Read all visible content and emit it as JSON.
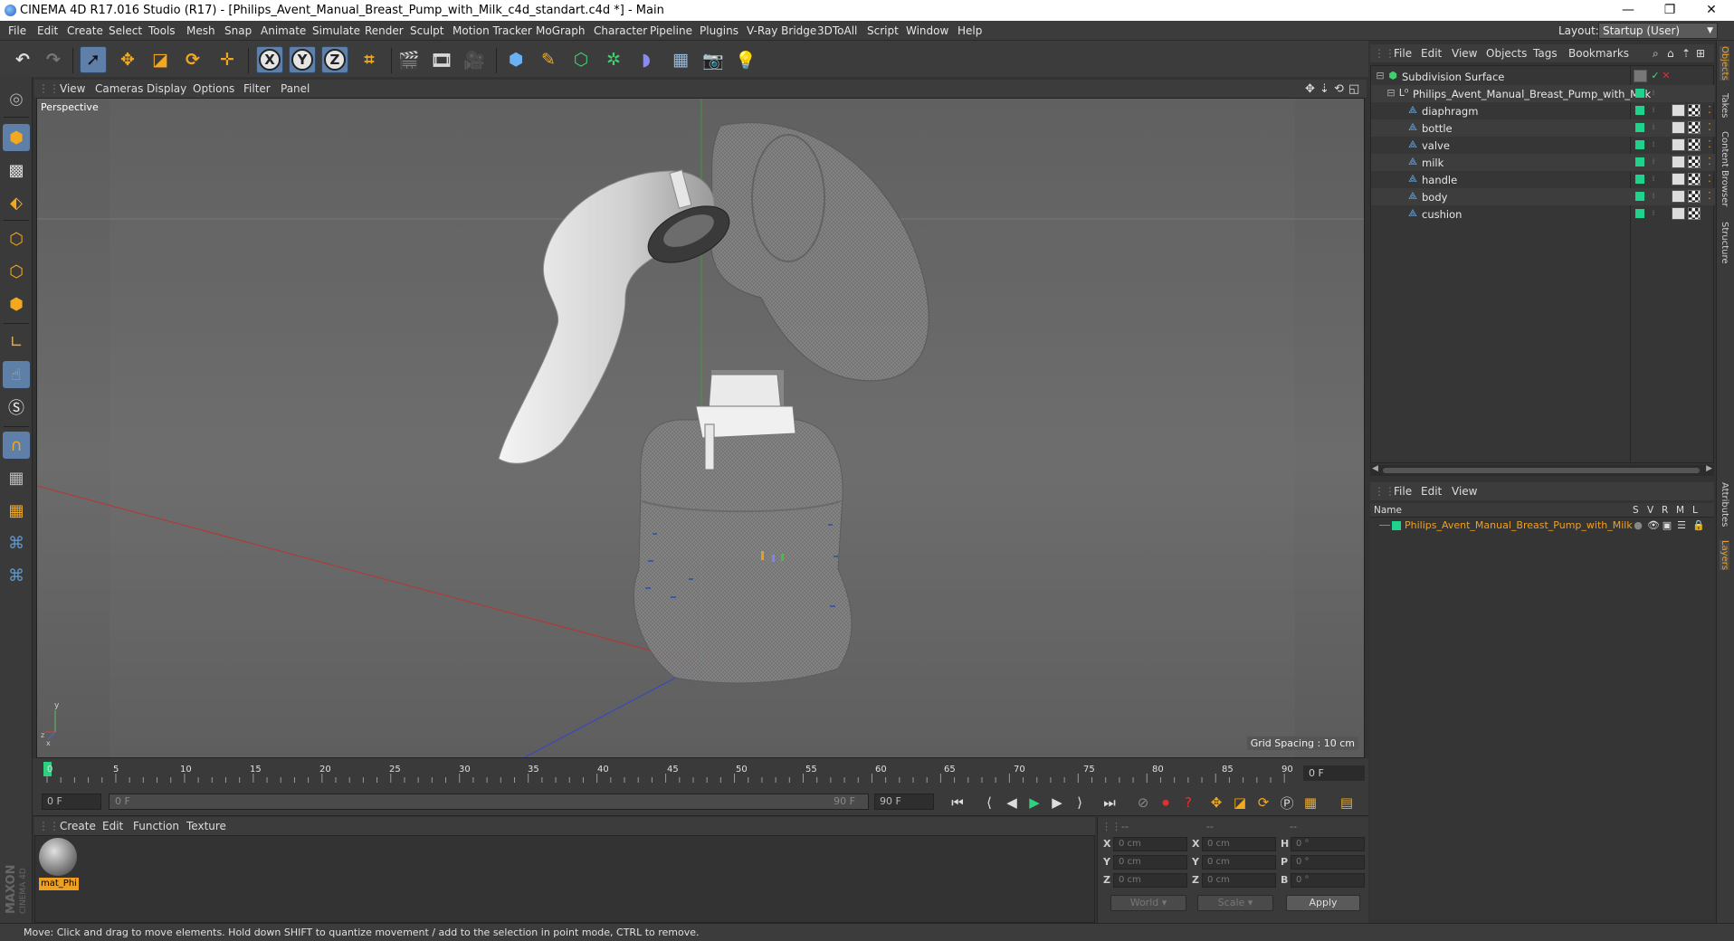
{
  "window": {
    "title": "CINEMA 4D R17.016 Studio (R17) - [Philips_Avent_Manual_Breast_Pump_with_Milk_c4d_standart.c4d *] - Main",
    "minimize": "—",
    "maximize": "❐",
    "close": "✕"
  },
  "menubar": {
    "items": [
      "File",
      "Edit",
      "Create",
      "Select",
      "Tools",
      "Mesh",
      "Snap",
      "Animate",
      "Simulate",
      "Render",
      "Sculpt",
      "Motion Tracker",
      "MoGraph",
      "Character",
      "Pipeline",
      "Plugins",
      "V-Ray Bridge",
      "3DToAll",
      "Script",
      "Window",
      "Help"
    ],
    "layout_label": "Layout:",
    "layout_value": "Startup (User)"
  },
  "toolbar": {
    "axis_x": "X",
    "axis_y": "Y",
    "axis_z": "Z"
  },
  "viewport": {
    "menu": [
      "View",
      "Cameras",
      "Display",
      "Options",
      "Filter",
      "Panel"
    ],
    "camera_label": "Perspective",
    "grid_spacing": "Grid Spacing : 10 cm",
    "axis_y": "y",
    "axis_z": "z",
    "axis_x": "x"
  },
  "timeline": {
    "ticks": [
      "0",
      "5",
      "10",
      "15",
      "20",
      "25",
      "30",
      "35",
      "40",
      "45",
      "50",
      "55",
      "60",
      "65",
      "70",
      "75",
      "80",
      "85",
      "90"
    ],
    "current_frame": "0 F",
    "start_field": "0 F",
    "range_start": "0 F",
    "range_end": "90 F",
    "end_field": "90 F"
  },
  "material_manager": {
    "menu": [
      "Create",
      "Edit",
      "Function",
      "Texture"
    ],
    "materials": [
      {
        "name": "mat_Phi"
      }
    ]
  },
  "coordinates": {
    "header": [
      "--",
      "--",
      "--"
    ],
    "rows": [
      {
        "l1": "X",
        "v1": "0 cm",
        "l2": "X",
        "v2": "0 cm",
        "l3": "H",
        "v3": "0 °"
      },
      {
        "l1": "Y",
        "v1": "0 cm",
        "l2": "Y",
        "v2": "0 cm",
        "l3": "P",
        "v3": "0 °"
      },
      {
        "l1": "Z",
        "v1": "0 cm",
        "l2": "Z",
        "v2": "0 cm",
        "l3": "B",
        "v3": "0 °"
      }
    ],
    "space": "World",
    "mode": "Scale",
    "apply": "Apply"
  },
  "object_manager": {
    "menu": [
      "File",
      "Edit",
      "View",
      "Objects",
      "Tags",
      "Bookmarks"
    ],
    "objects": [
      {
        "name": "Subdivision Surface",
        "level": 0
      },
      {
        "name": "Philips_Avent_Manual_Breast_Pump_with_Milk",
        "level": 1
      },
      {
        "name": "diaphragm",
        "level": 2
      },
      {
        "name": "bottle",
        "level": 2
      },
      {
        "name": "valve",
        "level": 2
      },
      {
        "name": "milk",
        "level": 2
      },
      {
        "name": "handle",
        "level": 2
      },
      {
        "name": "body",
        "level": 2
      },
      {
        "name": "cushion",
        "level": 2
      }
    ]
  },
  "layer_manager": {
    "menu": [
      "File",
      "Edit",
      "View"
    ],
    "columns": [
      "Name",
      "S",
      "V",
      "R",
      "M",
      "L"
    ],
    "layers": [
      {
        "name": "Philips_Avent_Manual_Breast_Pump_with_Milk",
        "color": "#1fd38c"
      }
    ]
  },
  "right_tabs": [
    "Objects",
    "Takes",
    "Content Browser",
    "Structure",
    "Attributes",
    "Layers"
  ],
  "status": "Move: Click and drag to move elements. Hold down SHIFT to quantize movement / add to the selection in point mode, CTRL to remove.",
  "colors": {
    "accent": "#f0a020",
    "visible": "#1fd38c",
    "selection": "#5d7fa8"
  }
}
